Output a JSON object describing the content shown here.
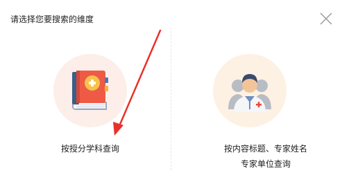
{
  "dialog": {
    "title": "请选择您要搜索的维度",
    "close_icon": "close-icon"
  },
  "options": {
    "subject": {
      "label": "按授分学科查询",
      "icon": "book-with-plus-icon",
      "circle_color": "#fdeee9"
    },
    "expert": {
      "label_line1": "按内容标题、专家姓名",
      "label_line2": "专家单位查询",
      "icon": "doctor-expert-icon",
      "circle_color": "#fdf1e3"
    }
  },
  "annotation": {
    "arrow_color": "#e8312a"
  }
}
